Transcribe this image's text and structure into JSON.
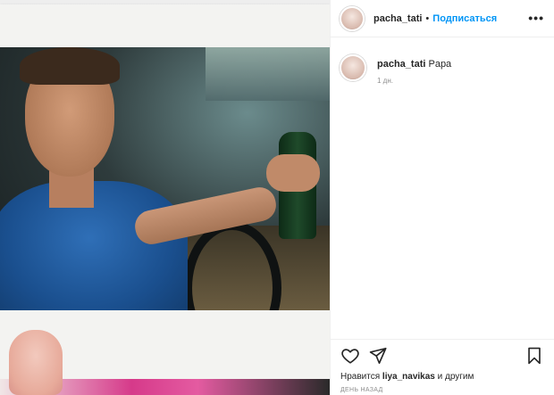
{
  "post": {
    "author": {
      "username": "pacha_tati",
      "separator": "•",
      "follow_label": "Подписаться",
      "more_label": "•••"
    },
    "caption": {
      "username": "pacha_tati",
      "text": "Papa",
      "time": "1 дн."
    },
    "actions": {
      "like_icon": "heart-icon",
      "share_icon": "paper-plane-icon",
      "save_icon": "bookmark-icon"
    },
    "likes": {
      "prefix": "Нравится",
      "liker": "liya_navikas",
      "suffix": "и другим"
    },
    "timestamp": "ДЕНЬ НАЗАД"
  },
  "colors": {
    "accent": "#0095f6",
    "text": "#262626",
    "muted": "#8e8e8e",
    "border": "#efefef"
  }
}
